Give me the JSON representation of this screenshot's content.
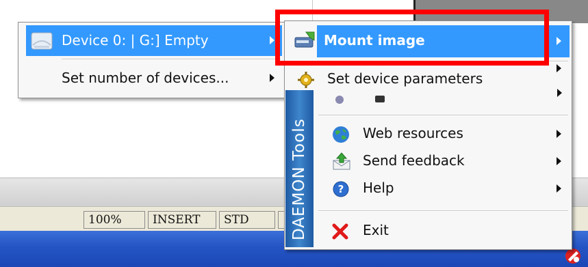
{
  "left_menu": {
    "items": [
      {
        "label": "Device 0: | G:] Empty",
        "highlighted": true,
        "icon": "cd-drive-icon"
      },
      {
        "label": "Set number of devices...",
        "highlighted": false
      }
    ]
  },
  "right_menu": {
    "brand_strip": "DAEMON Tools",
    "items": [
      {
        "label": "Mount image",
        "highlighted": true,
        "icon": "mount-image-icon"
      },
      {
        "label": "Set device parameters",
        "icon": "device-parameters-icon"
      },
      {
        "label": "Web resources",
        "icon": "globe-icon"
      },
      {
        "label": "Send feedback",
        "icon": "send-feedback-icon"
      },
      {
        "label": "Help",
        "icon": "help-icon"
      },
      {
        "label": "Exit",
        "icon": "exit-icon"
      }
    ]
  },
  "status_bar": {
    "cells": [
      "100%",
      "INSERT",
      "STD"
    ]
  },
  "colors": {
    "highlight": "#3399ff",
    "annotation_box": "#ff0000",
    "taskbar": "#2454c4"
  }
}
